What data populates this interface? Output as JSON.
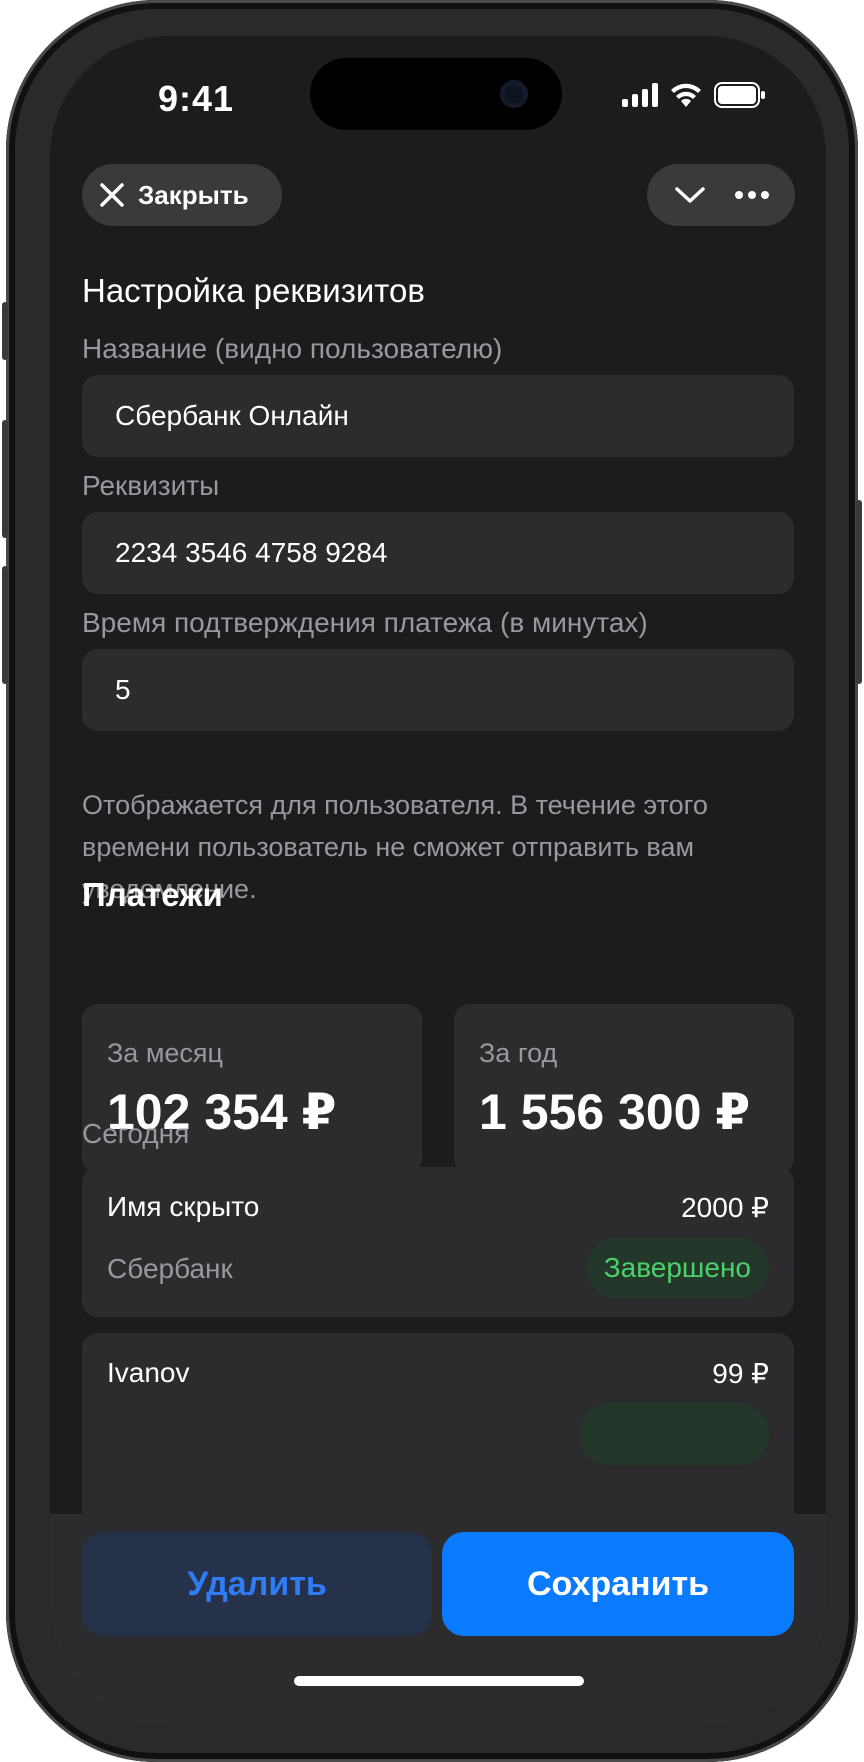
{
  "status_bar": {
    "time": "9:41"
  },
  "nav": {
    "close_label": "Закрыть"
  },
  "form": {
    "title": "Настройка реквизитов",
    "name_label": "Название (видно пользователю)",
    "name_value": "Сбербанк Онлайн",
    "requisites_label": "Реквизиты",
    "requisites_value": "2234 3546 4758 9284",
    "confirm_time_label": "Время подтверждения платежа (в минутах)",
    "confirm_time_value": "5",
    "hint": "Отображается для пользователя. В течение этого времени пользователь не сможет отправить вам уведомление."
  },
  "payments": {
    "title": "Платежи",
    "month_label": "За месяц",
    "month_value": "102 354 ₽",
    "year_label": "За год",
    "year_value": "1 556 300 ₽",
    "today_label": "Сегодня",
    "transactions": [
      {
        "name": "Имя скрыто",
        "amount": "2000 ₽",
        "bank": "Сбербанк",
        "status": "Завершено"
      },
      {
        "name": "Ivanov",
        "amount": "99 ₽"
      }
    ]
  },
  "actions": {
    "delete_label": "Удалить",
    "save_label": "Сохранить"
  },
  "colors": {
    "accent": "#0a7aff",
    "success": "#4cd16a",
    "background": "#1c1c1e",
    "card": "#2c2c2e"
  }
}
